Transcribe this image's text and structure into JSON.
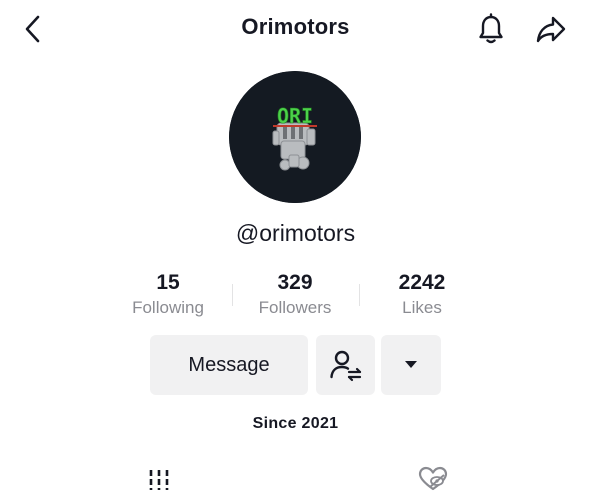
{
  "header": {
    "title": "Orimotors",
    "back_icon": "chevron-left-icon",
    "notification_icon": "bell-icon",
    "share_icon": "share-arrow-icon"
  },
  "profile": {
    "avatar_logo_text": "ORI",
    "username": "@orimotors",
    "since": "Since 2021"
  },
  "stats": [
    {
      "value": "15",
      "label": "Following"
    },
    {
      "value": "329",
      "label": "Followers"
    },
    {
      "value": "2242",
      "label": "Likes"
    }
  ],
  "actions": {
    "message_label": "Message",
    "follow_icon": "person-swap-icon",
    "more_icon": "caret-down-icon"
  },
  "tabs": [
    {
      "name": "videos",
      "icon": "grid-bars-icon"
    },
    {
      "name": "liked",
      "icon": "heart-hidden-icon"
    }
  ],
  "colors": {
    "text_primary": "#161823",
    "text_secondary": "#8a8b91",
    "button_bg": "#f1f1f2",
    "avatar_bg": "#141a22",
    "logo_green": "#4cd14a"
  }
}
